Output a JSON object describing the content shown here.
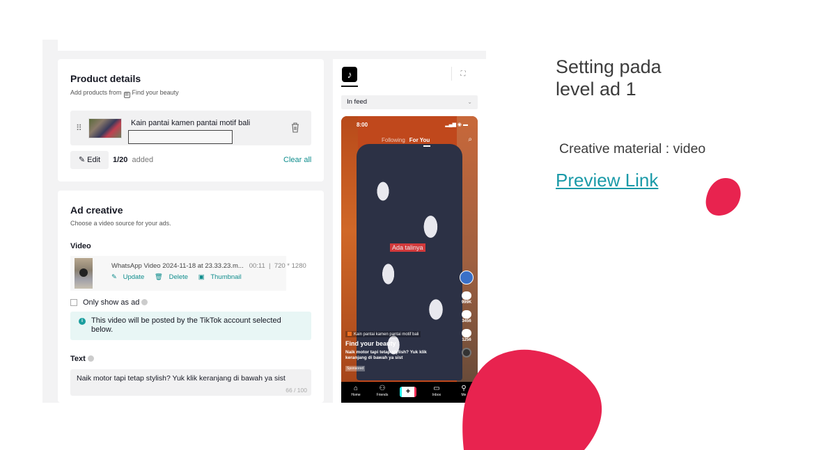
{
  "colors": {
    "accent_red": "#e8234f",
    "link_teal": "#1a9aa8",
    "tiktok_teal": "#0f8d8d",
    "notice_bg": "#e8f6f5"
  },
  "slide": {
    "title_line1": "Setting pada",
    "title_line2": "level ad 1",
    "creative_material": "Creative material : video",
    "preview_link": "Preview Link"
  },
  "product_details": {
    "title": "Product details",
    "subtitle_prefix": "Add products from",
    "shop_icon": "shop-icon",
    "shop_name": "Find your beauty",
    "product_name": "Kain pantai kamen pantai motif bali",
    "edit_label": "Edit",
    "count_value": "1/20",
    "count_suffix": "added",
    "clear_all": "Clear all"
  },
  "ad_creative": {
    "title": "Ad creative",
    "subtitle": "Choose a video source for your ads.",
    "video_label": "Video",
    "video_name": "WhatsApp Video 2024-11-18 at 23.33.23.m...",
    "video_duration": "00:11",
    "video_resolution": "720 * 1280",
    "update_label": "Update",
    "delete_label": "Delete",
    "thumbnail_label": "Thumbnail",
    "only_show_as_ad": "Only show as ad",
    "only_show_checked": false,
    "notice_text": "This video will be posted by the TikTok account selected below.",
    "text_label": "Text",
    "text_value": "Naik motor tapi tetap stylish? Yuk klik keranjang di bawah ya sist",
    "text_count": "66 / 100"
  },
  "preview": {
    "logo_icon": "tiktok-logo",
    "placement": "In feed",
    "phone": {
      "time": "8:00",
      "tab_following": "Following",
      "tab_for_you": "For You",
      "overlay_text": "Ada talinya",
      "likes": "999K",
      "comments": "3456",
      "shares": "1256",
      "product_tag": "Kain pantai kamen pantai motif bali",
      "author": "Find your beauty",
      "caption": "Naik motor tapi tetap stylish? Yuk klik keranjang di bawah ya sist",
      "sponsored": "Sponsored",
      "nav_home": "Home",
      "nav_friends": "Friends",
      "nav_inbox": "Inbox",
      "nav_me": "Me"
    }
  }
}
